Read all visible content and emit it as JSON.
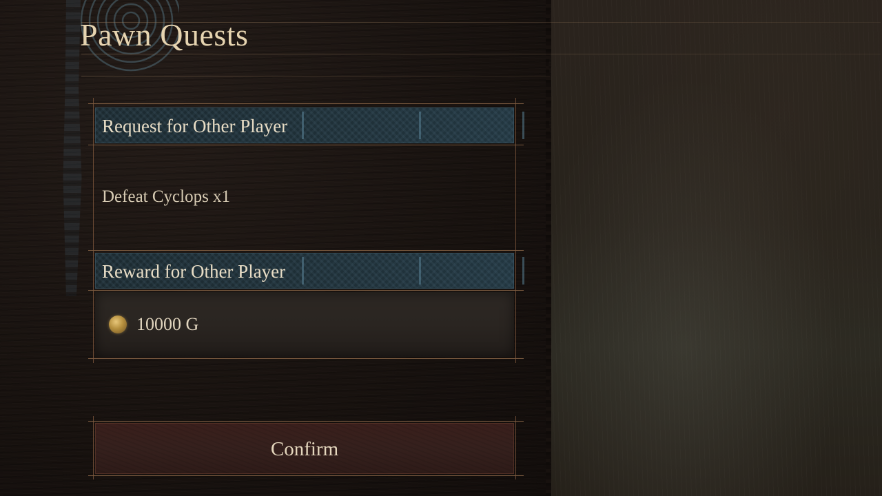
{
  "page": {
    "title": "Pawn Quests"
  },
  "request": {
    "header": "Request for Other Player",
    "objective": "Defeat Cyclops x1"
  },
  "reward": {
    "header": "Reward for Other Player",
    "icon": "gold-coin-icon",
    "value": "10000 G"
  },
  "actions": {
    "confirm_label": "Confirm"
  },
  "colors": {
    "title": "#e6d4b0",
    "header_bg": "#1f3038",
    "frame": "#7a5a3f",
    "confirm_bg": "#35201d"
  }
}
